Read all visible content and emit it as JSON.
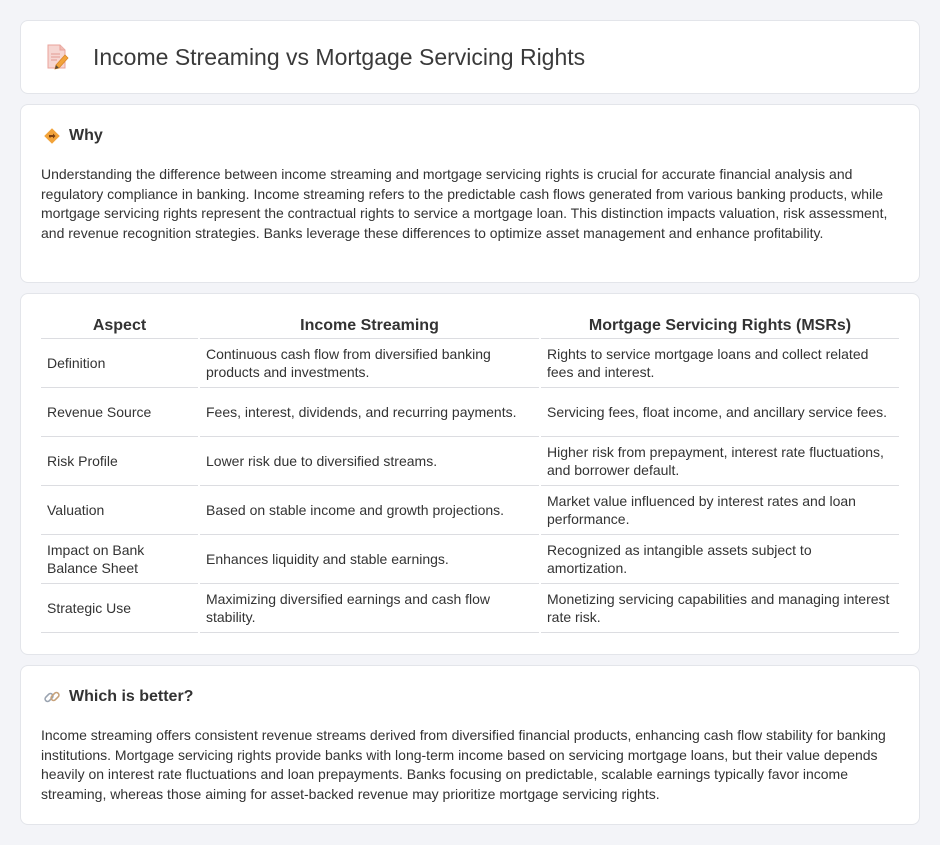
{
  "header": {
    "title": "Income Streaming vs Mortgage Servicing Rights"
  },
  "why": {
    "title": "Why",
    "text": "Understanding the difference between income streaming and mortgage servicing rights is crucial for accurate financial analysis and regulatory compliance in banking. Income streaming refers to the predictable cash flows generated from various banking products, while mortgage servicing rights represent the contractual rights to service a mortgage loan. This distinction impacts valuation, risk assessment, and revenue recognition strategies. Banks leverage these differences to optimize asset management and enhance profitability."
  },
  "comparison": {
    "headers": [
      "Aspect",
      "Income Streaming",
      "Mortgage Servicing Rights (MSRs)"
    ],
    "rows": [
      [
        "Definition",
        "Continuous cash flow from diversified banking products and investments.",
        "Rights to service mortgage loans and collect related fees and interest."
      ],
      [
        "Revenue Source",
        "Fees, interest, dividends, and recurring payments.",
        "Servicing fees, float income, and ancillary service fees."
      ],
      [
        "Risk Profile",
        "Lower risk due to diversified streams.",
        "Higher risk from prepayment, interest rate fluctuations, and borrower default."
      ],
      [
        "Valuation",
        "Based on stable income and growth projections.",
        "Market value influenced by interest rates and loan performance."
      ],
      [
        "Impact on Bank Balance Sheet",
        "Enhances liquidity and stable earnings.",
        "Recognized as intangible assets subject to amortization."
      ],
      [
        "Strategic Use",
        "Maximizing diversified earnings and cash flow stability.",
        "Monetizing servicing capabilities and managing interest rate risk."
      ]
    ]
  },
  "better": {
    "title": "Which is better?",
    "text": "Income streaming offers consistent revenue streams derived from diversified financial products, enhancing cash flow stability for banking institutions. Mortgage servicing rights provide banks with long-term income based on servicing mortgage loans, but their value depends heavily on interest rate fluctuations and loan prepayments. Banks focusing on predictable, scalable earnings typically favor income streaming, whereas those aiming for asset-backed revenue may prioritize mortgage servicing rights."
  },
  "icons": {
    "header": "document-pencil-icon",
    "why": "diamond-direction-icon",
    "better": "link-icon"
  },
  "colors": {
    "accent_orange": "#f2a33a",
    "accent_pink": "#e57373",
    "link_gray": "#9aa3b0"
  }
}
